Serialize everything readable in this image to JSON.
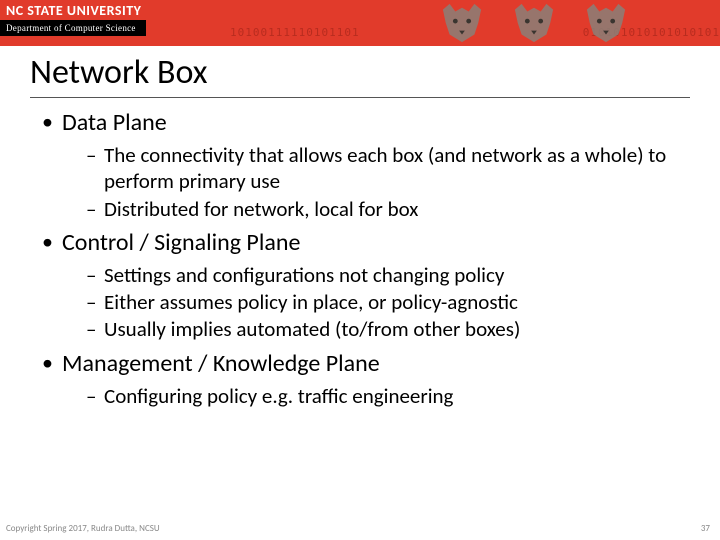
{
  "header": {
    "university": "NC STATE UNIVERSITY",
    "department": "Department of Computer Science",
    "binary_left": "10100111110101101",
    "binary_right": "010101010101010101"
  },
  "slide": {
    "title": "Network Box",
    "bullets": [
      {
        "text": "Data Plane",
        "sub": [
          "The connectivity that allows each box (and network as a whole) to perform primary use",
          "Distributed for network, local for box"
        ]
      },
      {
        "text": "Control / Signaling Plane",
        "sub": [
          "Settings and configurations not changing policy",
          "Either assumes policy in place, or policy-agnostic",
          "Usually implies automated (to/from other boxes)"
        ]
      },
      {
        "text": "Management / Knowledge Plane",
        "sub": [
          "Configuring policy e.g. traffic engineering"
        ]
      }
    ]
  },
  "footer": {
    "copyright": "Copyright Spring 2017, Rudra Dutta, NCSU",
    "page": "37"
  }
}
